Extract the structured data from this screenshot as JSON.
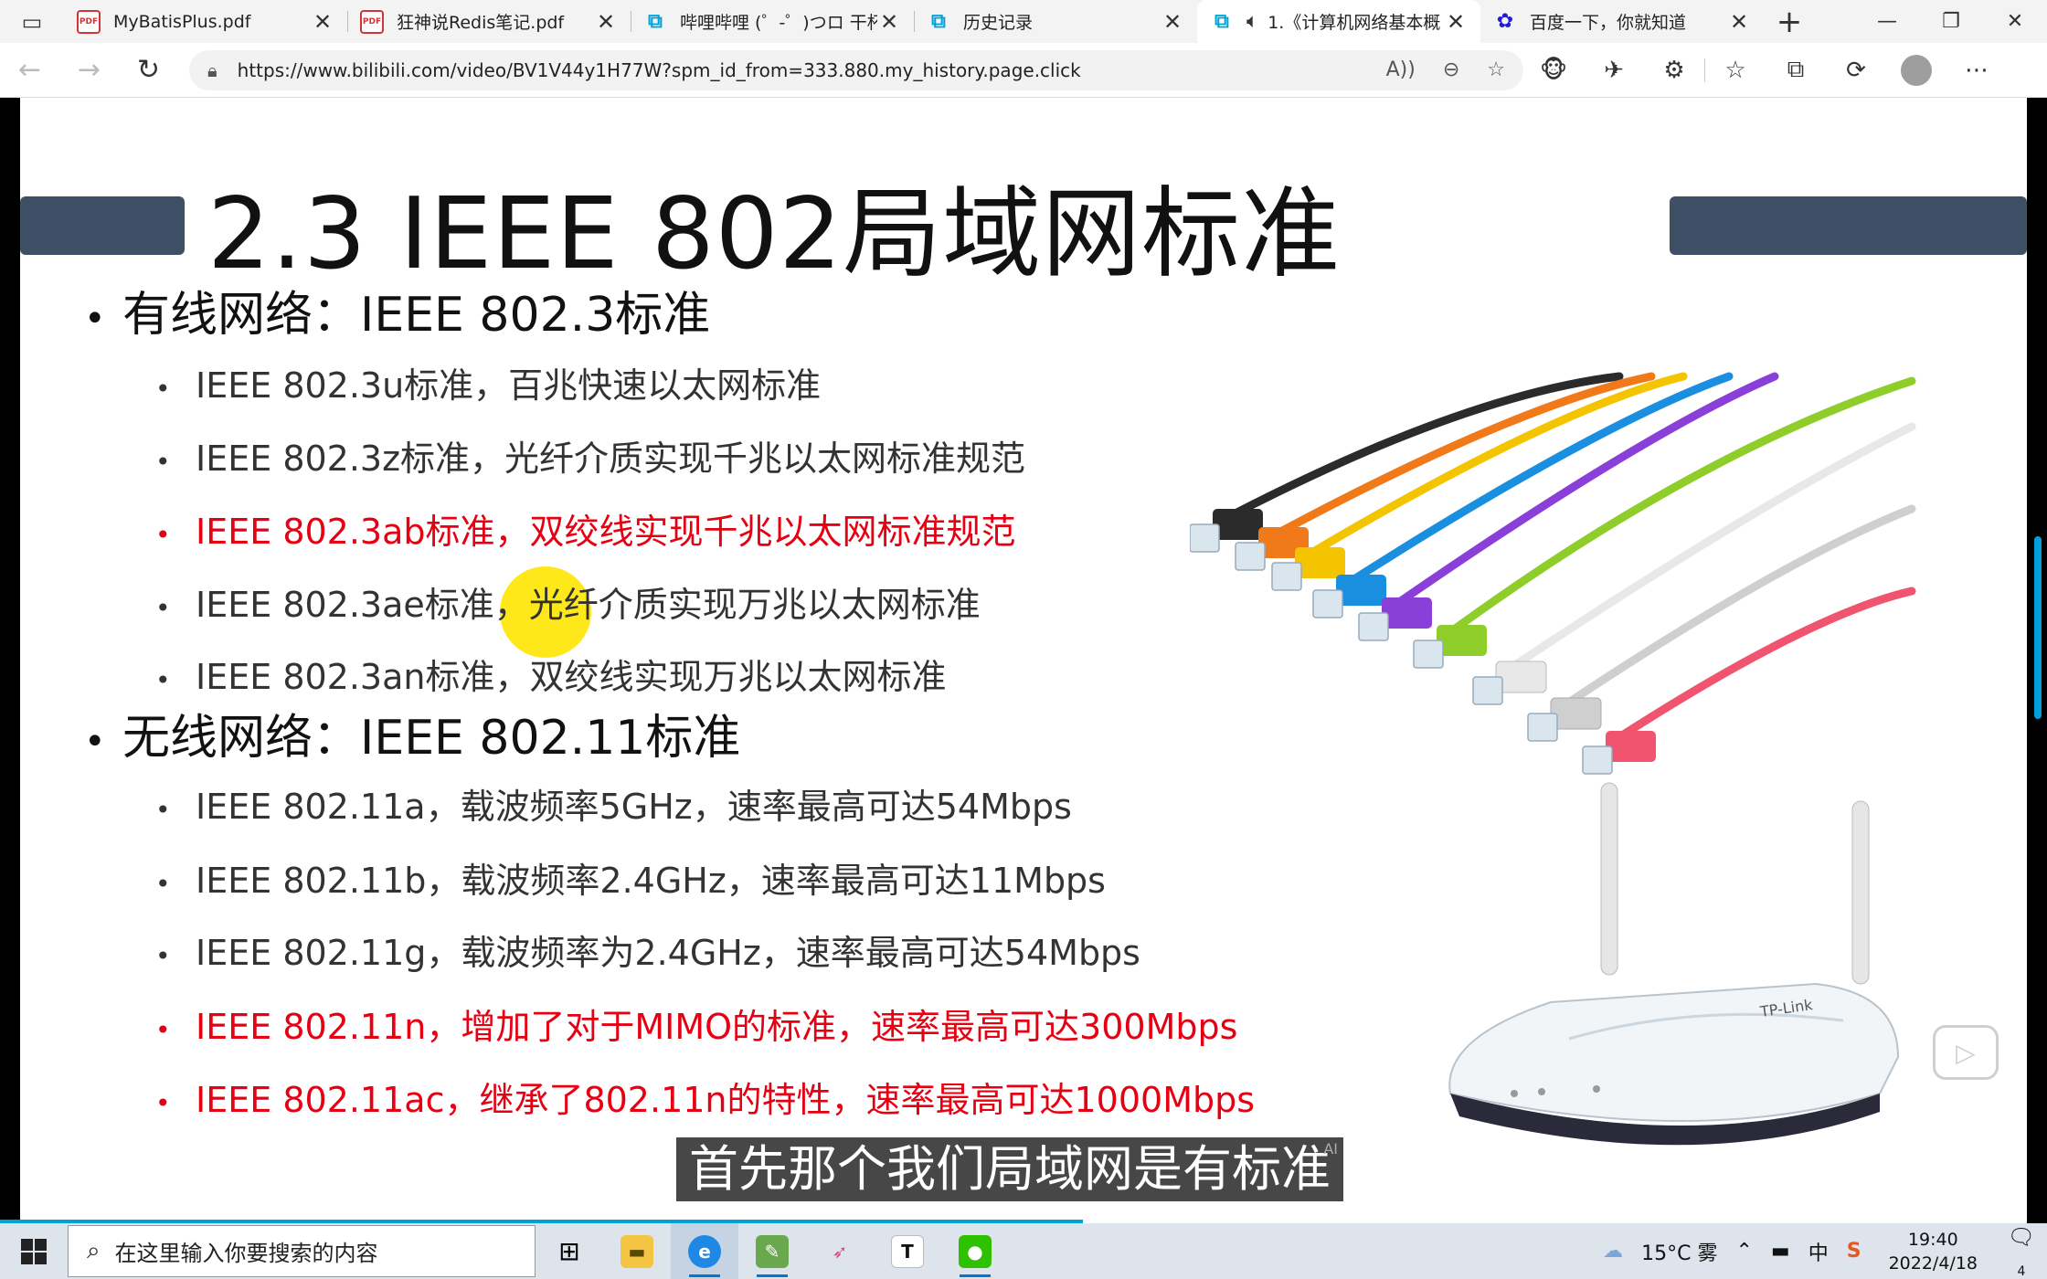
{
  "browser": {
    "tabs": [
      {
        "title": "MyBatisPlus.pdf",
        "icon": "pdf-icon",
        "active": false
      },
      {
        "title": "狂神说Redis笔记.pdf",
        "icon": "pdf-icon",
        "active": false
      },
      {
        "title": "哔哩哔哩 (゜-゜)つロ 干杯",
        "icon": "bilibili-icon",
        "active": false
      },
      {
        "title": "历史记录",
        "icon": "bilibili-icon",
        "active": false
      },
      {
        "title": "1.《计算机网络基本概",
        "icon": "bilibili-icon",
        "active": true,
        "playing_audio": true
      },
      {
        "title": "百度一下，你就知道",
        "icon": "baidu-icon",
        "active": false
      }
    ],
    "url": "https://www.bilibili.com/video/BV1V44y1H77W?spm_id_from=333.880.my_history.page.click"
  },
  "slide": {
    "title": "2.3 IEEE 802局域网标准",
    "sections": [
      {
        "heading": "有线网络：IEEE 802.3标准",
        "items": [
          {
            "text": "IEEE 802.3u标准，百兆快速以太网标准",
            "highlight": false
          },
          {
            "text": "IEEE 802.3z标准，光纤介质实现千兆以太网标准规范",
            "highlight": false
          },
          {
            "text": "IEEE 802.3ab标准，双绞线实现千兆以太网标准规范",
            "highlight": true
          },
          {
            "text": "IEEE 802.3ae标准，光纤介质实现万兆以太网标准",
            "highlight": false
          },
          {
            "text": "IEEE 802.3an标准，双绞线实现万兆以太网标准",
            "highlight": false
          }
        ]
      },
      {
        "heading": "无线网络：IEEE 802.11标准",
        "items": [
          {
            "text": "IEEE 802.11a，载波频率5GHz，速率最高可达54Mbps",
            "highlight": false
          },
          {
            "text": "IEEE 802.11b，载波频率2.4GHz，速率最高可达11Mbps",
            "highlight": false
          },
          {
            "text": "IEEE 802.11g，载波频率为2.4GHz，速率最高可达54Mbps",
            "highlight": false
          },
          {
            "text": "IEEE 802.11n，增加了对于MIMO的标准，速率最高可达300Mbps",
            "highlight": true
          },
          {
            "text": "IEEE 802.11ac，继承了802.11n的特性，速率最高可达1000Mbps",
            "highlight": true
          }
        ]
      }
    ],
    "router_brand": "TP-Link",
    "highlight_color": "#e60012"
  },
  "player": {
    "subtitle": "首先那个我们局域网是有标准",
    "ai_tag": "AI"
  },
  "taskbar": {
    "search_placeholder": "在这里输入你要搜索的内容",
    "weather": "15°C 雾",
    "ime": "中",
    "time": "19:40",
    "date": "2022/4/18",
    "notification_count": "4"
  }
}
